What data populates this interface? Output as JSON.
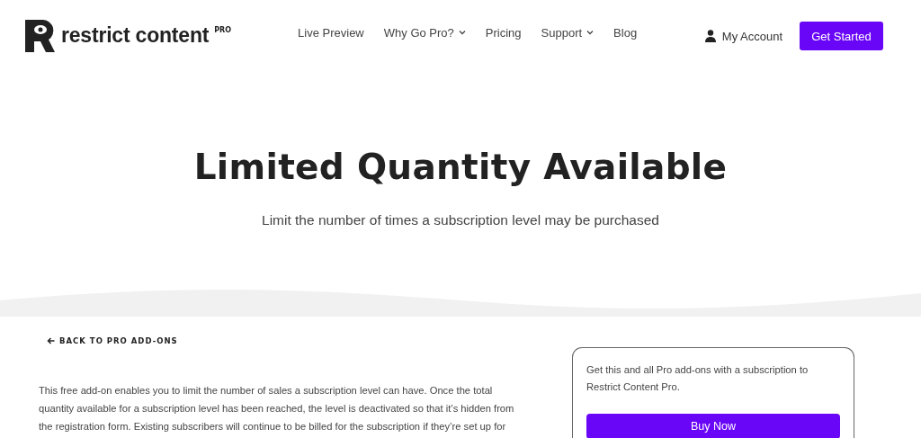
{
  "header": {
    "logo": {
      "wordmark": "restrict content",
      "badge": "PRO"
    },
    "nav": [
      {
        "label": "Live Preview",
        "dropdown": false
      },
      {
        "label": "Why Go Pro?",
        "dropdown": true
      },
      {
        "label": "Pricing",
        "dropdown": false
      },
      {
        "label": "Support",
        "dropdown": true
      },
      {
        "label": "Blog",
        "dropdown": false
      }
    ],
    "account_link": "My Account",
    "cta_button": "Get Started"
  },
  "hero": {
    "title": "Limited Quantity Available",
    "subtitle": "Limit the number of times a subscription level may be purchased"
  },
  "back_link": "BACK TO PRO ADD-ONS",
  "description": "This free add-on enables you to limit the number of sales a subscription level can have. Once the total quantity available for a subscription level has been reached, the level is deactivated so that it’s hidden from the registration form. Existing subscribers will continue to be billed for the subscription if they’re set up for",
  "purchase_card": {
    "text": "Get this and all Pro add-ons with a subscription to Restrict Content Pro.",
    "button": "Buy Now"
  }
}
